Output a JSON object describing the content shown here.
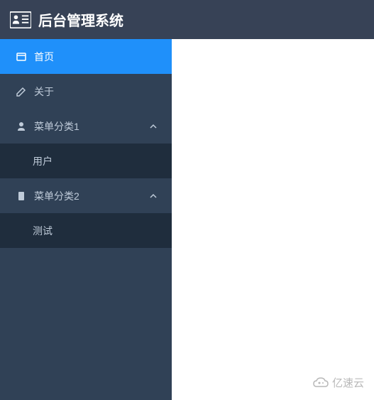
{
  "header": {
    "title": "后台管理系统"
  },
  "sidebar": {
    "items": [
      {
        "label": "首页",
        "icon": "home-icon"
      },
      {
        "label": "关于",
        "icon": "edit-icon"
      },
      {
        "label": "菜单分类1",
        "icon": "user-icon"
      },
      {
        "label": "用户"
      },
      {
        "label": "菜单分类2",
        "icon": "doc-icon"
      },
      {
        "label": "测试"
      }
    ]
  },
  "watermark": {
    "text": "亿速云"
  }
}
